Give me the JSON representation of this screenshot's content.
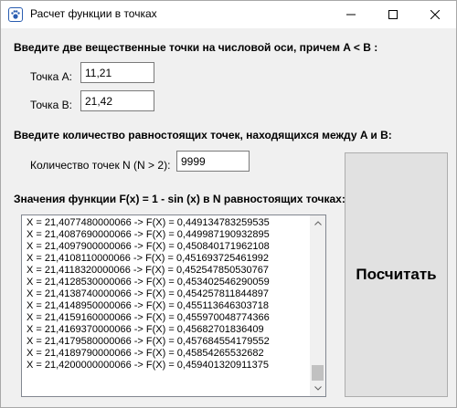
{
  "window": {
    "title": "Расчет функции в точках",
    "app_icon": "paw-icon",
    "minimize_glyph": "—",
    "maximize_glyph": "☐",
    "close_glyph": "✕"
  },
  "form": {
    "heading_points": "Введите две вещественные точки на числовой оси, причем A < B :",
    "label_a": "Точка А:",
    "value_a": "11,21",
    "label_b": "Точка В:",
    "value_b": "21,42",
    "heading_count": "Введите количество равностоящих точек, находящихся между A и B:",
    "label_n": "Количество точек N (N > 2):",
    "value_n": "9999",
    "heading_values": "Значения функции F(x) = 1 - sin (x) в N равностоящих точках:",
    "calculate_label": "Посчитать"
  },
  "results": [
    "X = 21,4077480000066 -> F(X) = 0,449134783259535",
    "X = 21,4087690000066 -> F(X) = 0,449987190932895",
    "X = 21,4097900000066 -> F(X) = 0,450840171962108",
    "X = 21,4108110000066 -> F(X) = 0,451693725461992",
    "X = 21,4118320000066 -> F(X) = 0,452547850530767",
    "X = 21,4128530000066 -> F(X) = 0,453402546290059",
    "X = 21,4138740000066 -> F(X) = 0,454257811844897",
    "X = 21,4148950000066 -> F(X) = 0,455113646303718",
    "X = 21,4159160000066 -> F(X) = 0,455970048774366",
    "X = 21,4169370000066 -> F(X) = 0,45682701836409",
    "X = 21,4179580000066 -> F(X) = 0,457684554179552",
    "X = 21,4189790000066 -> F(X) = 0,45854265532682",
    "X = 21,4200000000066 -> F(X) = 0,459401320911375"
  ]
}
